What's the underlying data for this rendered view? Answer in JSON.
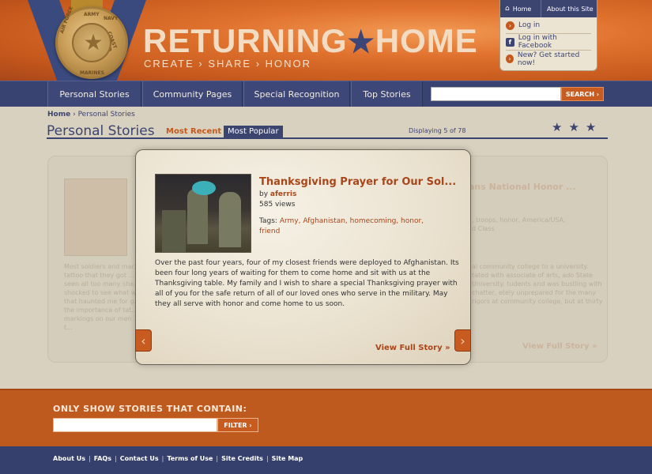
{
  "brand": {
    "logo_left": "RETURNING",
    "logo_star": "★",
    "logo_right": "HOME",
    "tagline": "CREATE › SHARE › HONOR",
    "medal_words": [
      "ARMY",
      "NAVY",
      "AIR FORCE",
      "COAST GUARD",
      "MARINES"
    ]
  },
  "top_nav": {
    "home": "Home",
    "about": "About this Site"
  },
  "user_menu": [
    {
      "icon": "arrow-circle-icon",
      "glyph": "›",
      "label": "Log in"
    },
    {
      "icon": "facebook-icon",
      "glyph": "f",
      "label": "Log in with Facebook"
    },
    {
      "icon": "arrow-circle-icon",
      "glyph": "›",
      "label": "New? Get started now!"
    }
  ],
  "main_nav": [
    "Personal Stories",
    "Community Pages",
    "Special Recognition",
    "Top Stories"
  ],
  "search": {
    "button": "SEARCH ›",
    "value": ""
  },
  "breadcrumb": {
    "home": "Home",
    "sep": "›",
    "current": "Personal Stories"
  },
  "page": {
    "title": "Personal Stories",
    "tab_recent": "Most Recent",
    "tab_popular": "Most Popular",
    "displaying": "Displaying 5 of 78",
    "stars": "★★★"
  },
  "bg_left": {
    "text": "Most soldiers and mar... tattoo that they got ... seen all too many sha... shocked to see what w... that haunted me for g... the importance of tat... markings on our men ... as t..."
  },
  "bg_right": {
    "title": "ans National Honor ...",
    "tags": ", troops, honor, America/USA,",
    "tags2": "d Class",
    "text": "al community college to a university. tated with associate of arts, ado State University. tudents and was bustling with chatter, etely unprepared for the many rigors at community college, but at thirty",
    "link": "View Full Story »"
  },
  "story": {
    "title": "Thanksgiving Prayer for Our Sol...",
    "by_label": "by",
    "author": "aferris",
    "views": "585 views",
    "tags_label": "Tags:",
    "tags": "Army, Afghanistan, homecoming, honor, friend",
    "body": "Over the past four years, four of my closest friends were deployed to Afghanistan.  Its been four long years of waiting for them to come home and sit with us at the Thanksgiving table. My family and I wish to share a special Thanksgiving prayer with all of you for the safe return of all of our loved ones who serve in the military.  May they all serve with honor and come home to us soon.",
    "view_full": "View Full Story »"
  },
  "filter": {
    "label": "ONLY SHOW STORIES THAT CONTAIN:",
    "button": "FILTER ›",
    "value": ""
  },
  "footer": [
    "About Us",
    "FAQs",
    "Contact Us",
    "Terms of Use",
    "Site Credits",
    "Site Map"
  ],
  "colors": {
    "navy": "#3c4470",
    "orange": "#c5581c",
    "parchment": "#d9d1bf"
  }
}
